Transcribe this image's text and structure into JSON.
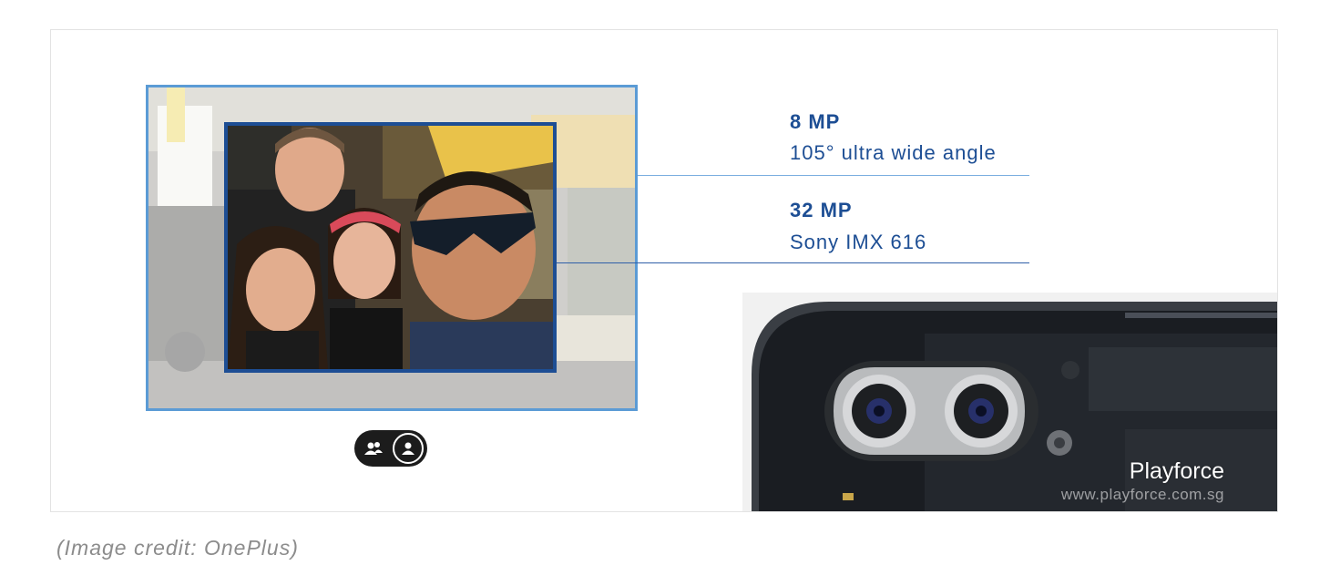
{
  "specs": [
    {
      "mp": "8 MP",
      "description": "105° ultra wide angle"
    },
    {
      "mp": "32 MP",
      "description": "Sony IMX 616"
    }
  ],
  "toggle": {
    "options": [
      {
        "icon": "group-icon",
        "selected": false
      },
      {
        "icon": "person-icon",
        "selected": true
      }
    ]
  },
  "watermark": {
    "name": "Playforce",
    "url": "www.playforce.com.sg"
  },
  "credit": "(Image credit: OnePlus)",
  "colors": {
    "accent_dark": "#1d4e94",
    "accent_light": "#5b9bd5",
    "toggle_bg": "#1c1c1c",
    "credit_text": "#8c8c8c"
  }
}
